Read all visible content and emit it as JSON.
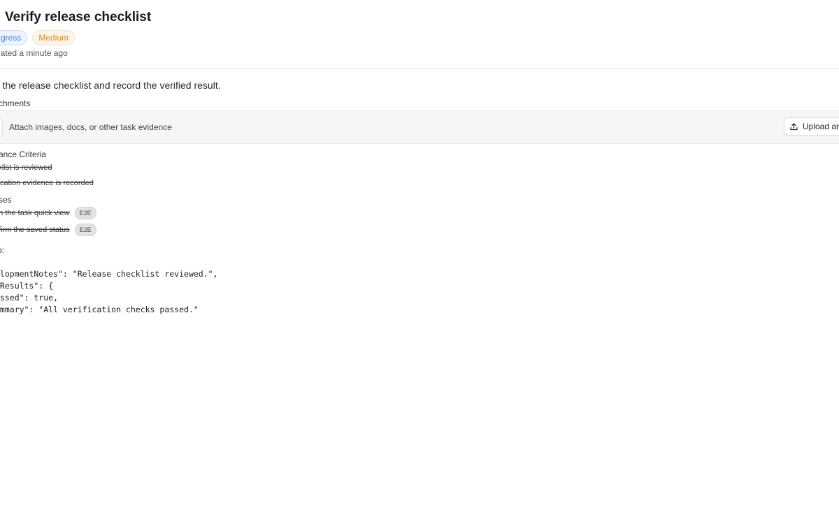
{
  "task": {
    "title": "Verify release checklist",
    "status_badge": "gress",
    "priority_badge": "Medium",
    "updated": "dated a minute ago",
    "description": "m the release checklist and record the verified result."
  },
  "attachments": {
    "heading": "chments",
    "hint": "Attach images, docs, or other task evidence",
    "upload_label": "Upload arti",
    "upload_icon": "upload-icon"
  },
  "acceptance": {
    "heading": "ance Criteria",
    "items": [
      "cklist is reviewed",
      "ification evidence is recorded"
    ]
  },
  "test_cases": {
    "heading": "ses",
    "items": [
      {
        "label": "en the task quick view",
        "tag": "E2E"
      },
      {
        "label": "nfirm the saved status",
        "tag": "E2E"
      }
    ]
  },
  "output": {
    "label": "o:",
    "lines": [
      "elopmentNotes\": \"Release checklist reviewed.\",",
      "tResults\": {",
      "assed\": true,",
      "ummary\": \"All verification checks passed.\""
    ]
  },
  "colors": {
    "status_text": "#4d7fd4",
    "priority_text": "#d48a2c"
  }
}
